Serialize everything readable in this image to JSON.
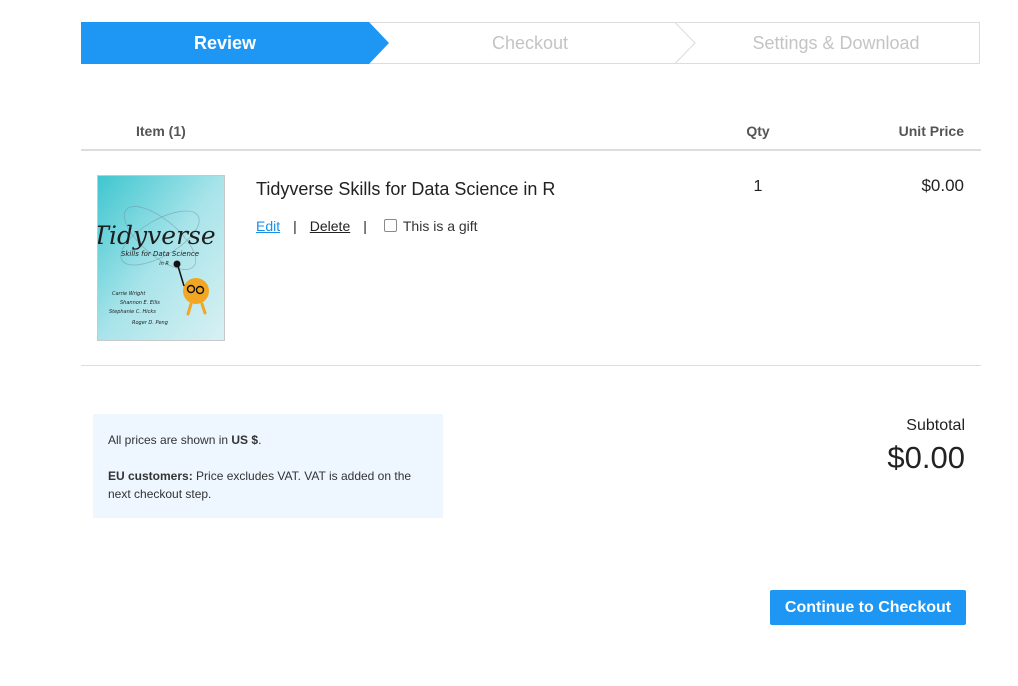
{
  "steps": [
    {
      "label": "Review",
      "state": "active"
    },
    {
      "label": "Checkout",
      "state": "inactive"
    },
    {
      "label": "Settings & Download",
      "state": "inactive"
    }
  ],
  "table": {
    "headers": {
      "item": "Item (1)",
      "qty": "Qty",
      "unit_price": "Unit Price"
    }
  },
  "item": {
    "title": "Tidyverse Skills for Data Science in R",
    "qty": "1",
    "unit_price": "$0.00",
    "edit_label": "Edit",
    "delete_label": "Delete",
    "separator": "|",
    "gift_label": "This is a gift",
    "gift_checked": false,
    "cover": {
      "title": "Tidyverse",
      "subtitle": "Skills for Data Science",
      "subtitle2": "in R",
      "authors": [
        "Carrie Wright",
        "Shannon E. Ellis",
        "Stephanie C. Hicks",
        "Roger D. Peng"
      ]
    }
  },
  "info": {
    "line1_prefix": "All prices are shown in ",
    "line1_currency": "US $",
    "line1_suffix": ".",
    "line2_bold": "EU customers:",
    "line2_text": " Price excludes VAT. VAT is added on the next checkout step."
  },
  "subtotal": {
    "label": "Subtotal",
    "value": "$0.00"
  },
  "cta": {
    "label": "Continue to Checkout"
  },
  "colors": {
    "accent": "#1e96f3",
    "link": "#1b8fe6",
    "info_bg": "#eef6ff"
  }
}
